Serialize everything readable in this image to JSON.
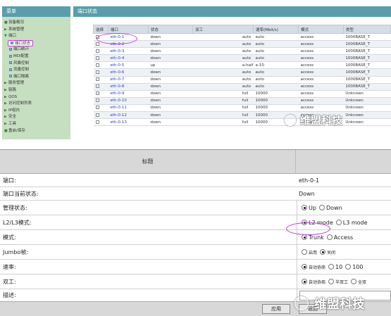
{
  "top": {
    "menu_title": "菜单",
    "panel_title": "端口状态",
    "sidebar": [
      {
        "label": "设备概况",
        "indent": false,
        "arrow": "■"
      },
      {
        "label": "系统管理",
        "indent": false,
        "arrow": "▶"
      },
      {
        "label": "端口",
        "indent": false,
        "arrow": "▼"
      },
      {
        "label": "端口状态",
        "indent": true,
        "arrow": "",
        "selected": true
      },
      {
        "label": "端口统计",
        "indent": true,
        "arrow": ""
      },
      {
        "label": "MDI配置",
        "indent": true,
        "arrow": "▶"
      },
      {
        "label": "风暴控制",
        "indent": true,
        "arrow": "▶"
      },
      {
        "label": "流量控制",
        "indent": true,
        "arrow": ""
      },
      {
        "label": "端口隔离",
        "indent": true,
        "arrow": ""
      },
      {
        "label": "服务管理",
        "indent": false,
        "arrow": "▶"
      },
      {
        "label": "链路",
        "indent": false,
        "arrow": "▶"
      },
      {
        "label": "QOS",
        "indent": false,
        "arrow": "▶"
      },
      {
        "label": "访问控制列表",
        "indent": false,
        "arrow": "▶"
      },
      {
        "label": "IP组白",
        "indent": false,
        "arrow": "▶"
      },
      {
        "label": "安全",
        "indent": false,
        "arrow": "▶"
      },
      {
        "label": "工具",
        "indent": false,
        "arrow": "▶"
      },
      {
        "label": "重启/保存",
        "indent": false,
        "arrow": "■"
      }
    ],
    "columns": [
      "选择",
      "端口",
      "状态",
      "双工",
      "速率(Mbit/s)",
      "模式",
      "类型"
    ],
    "rows": [
      [
        "eth-0-1",
        "down",
        "",
        "auto",
        "auto",
        "access",
        "1000BASE_T"
      ],
      [
        "eth-0-2",
        "down",
        "",
        "auto",
        "auto",
        "access",
        "1000BASE_T"
      ],
      [
        "eth-0-3",
        "down",
        "",
        "auto",
        "auto",
        "access",
        "1000BASE_T"
      ],
      [
        "eth-0-4",
        "down",
        "",
        "auto",
        "auto",
        "access",
        "1000BASE_T"
      ],
      [
        "eth-0-5",
        "up",
        "",
        "a-half",
        "a-10",
        "access",
        "1000BASE_T"
      ],
      [
        "eth-0-6",
        "down",
        "",
        "auto",
        "auto",
        "access",
        "1000BASE_T"
      ],
      [
        "eth-0-7",
        "down",
        "",
        "auto",
        "auto",
        "access",
        "1000BASE_T"
      ],
      [
        "eth-0-8",
        "down",
        "",
        "auto",
        "auto",
        "access",
        "1000BASE_T"
      ],
      [
        "eth-0-9",
        "down",
        "",
        "full",
        "10000",
        "access",
        "Unknown"
      ],
      [
        "eth-0-10",
        "down",
        "",
        "full",
        "10000",
        "access",
        "Unknown"
      ],
      [
        "eth-0-11",
        "down",
        "",
        "full",
        "10000",
        "access",
        "Unknown"
      ],
      [
        "eth-0-12",
        "down",
        "",
        "full",
        "10000",
        "access",
        "Unknown"
      ],
      [
        "eth-0-13",
        "down",
        "",
        "full",
        "10000",
        "access",
        "Unknown"
      ]
    ]
  },
  "bottom": {
    "title": "标题",
    "port_label": "端口:",
    "port_value": "eth-0-1",
    "state_label": "端口当前状态:",
    "state_value": "Down",
    "admin_label": "管理状态:",
    "admin_opts": [
      "Up",
      "Down"
    ],
    "l2l3_label": "L2/L3模式:",
    "l2l3_opts": [
      "L2 mode",
      "L3 mode"
    ],
    "mode_label": "模式:",
    "mode_opts": [
      "Trunk",
      "Access"
    ],
    "jumbo_label": "Jumbo帧:",
    "jumbo_opts": [
      "启用",
      "关闭"
    ],
    "speed_label": "速率:",
    "speed_opts": [
      "自动协商",
      "10",
      "100"
    ],
    "duplex_label": "双工:",
    "duplex_opts": [
      "自动协商",
      "半双工",
      "全双"
    ],
    "desc_label": "描述:",
    "apply_label": "应用",
    "back_label": "返回"
  },
  "watermark": "维盟科技"
}
